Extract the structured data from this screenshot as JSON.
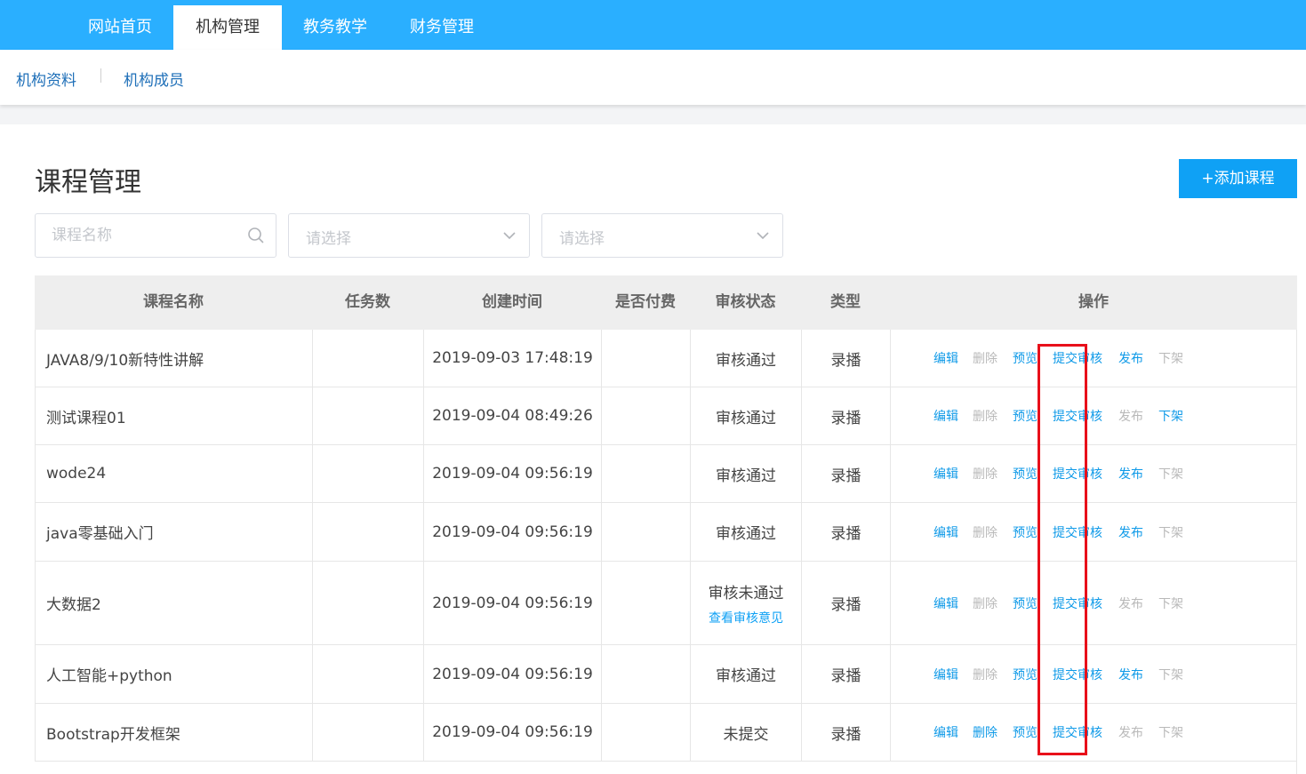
{
  "top_nav": {
    "tabs": [
      "网站首页",
      "机构管理",
      "教务教学",
      "财务管理"
    ],
    "active": "机构管理"
  },
  "sub_nav": {
    "items": [
      "机构资料",
      "机构成员"
    ]
  },
  "page": {
    "title": "课程管理",
    "add_button": "+添加课程"
  },
  "filters": {
    "search_placeholder": "课程名称",
    "select1_placeholder": "请选择",
    "select2_placeholder": "请选择"
  },
  "table": {
    "headers": [
      "课程名称",
      "任务数",
      "创建时间",
      "是否付费",
      "审核状态",
      "类型",
      "操作"
    ],
    "action_labels": [
      "编辑",
      "删除",
      "预览",
      "提交审核",
      "发布",
      "下架"
    ],
    "rows": [
      {
        "name": "JAVA8/9/10新特性讲解",
        "tasks": "",
        "created": "2019-09-03 17:48:19",
        "paid": "",
        "status": "审核通过",
        "status_link": "",
        "type": "录播",
        "enabled": [
          true,
          false,
          true,
          true,
          true,
          false
        ]
      },
      {
        "name": "测试课程01",
        "tasks": "",
        "created": "2019-09-04 08:49:26",
        "paid": "",
        "status": "审核通过",
        "status_link": "",
        "type": "录播",
        "enabled": [
          true,
          false,
          true,
          true,
          false,
          true
        ]
      },
      {
        "name": "wode24",
        "tasks": "",
        "created": "2019-09-04 09:56:19",
        "paid": "",
        "status": "审核通过",
        "status_link": "",
        "type": "录播",
        "enabled": [
          true,
          false,
          true,
          true,
          true,
          false
        ]
      },
      {
        "name": "java零基础入门",
        "tasks": "",
        "created": "2019-09-04 09:56:19",
        "paid": "",
        "status": "审核通过",
        "status_link": "",
        "type": "录播",
        "enabled": [
          true,
          false,
          true,
          true,
          true,
          false
        ]
      },
      {
        "name": "大数据2",
        "tasks": "",
        "created": "2019-09-04 09:56:19",
        "paid": "",
        "status": "审核未通过",
        "status_link": "查看审核意见",
        "type": "录播",
        "enabled": [
          true,
          false,
          true,
          true,
          false,
          false
        ]
      },
      {
        "name": "人工智能+python",
        "tasks": "",
        "created": "2019-09-04 09:56:19",
        "paid": "",
        "status": "审核通过",
        "status_link": "",
        "type": "录播",
        "enabled": [
          true,
          false,
          true,
          true,
          true,
          false
        ]
      },
      {
        "name": "Bootstrap开发框架",
        "tasks": "",
        "created": "2019-09-04 09:56:19",
        "paid": "",
        "status": "未提交",
        "status_link": "",
        "type": "录播",
        "enabled": [
          true,
          true,
          true,
          true,
          false,
          false
        ]
      }
    ]
  },
  "colors": {
    "nav": "#2aafff",
    "primary": "#0fa1f5",
    "link": "#0f9ae8",
    "disabled": "#b9b9b9",
    "highlight": "#e8101a"
  }
}
